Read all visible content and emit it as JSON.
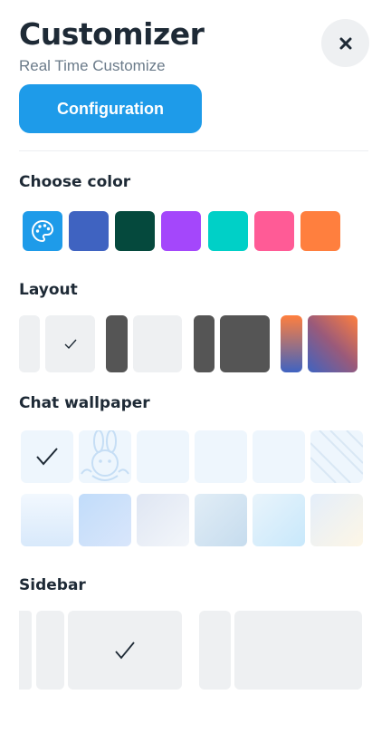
{
  "header": {
    "title": "Customizer",
    "subtitle": "Real Time Customize",
    "close_icon": "close-icon"
  },
  "configuration_button": {
    "label": "Configuration"
  },
  "sections": {
    "color": {
      "title": "Choose color"
    },
    "layout": {
      "title": "Layout"
    },
    "wallpaper": {
      "title": "Chat wallpaper"
    },
    "sidebar": {
      "title": "Sidebar"
    }
  },
  "colors": [
    {
      "name": "palette",
      "hex": "#1e9be9",
      "icon": "palette-icon",
      "selected": true
    },
    {
      "name": "blue",
      "hex": "#3f63c1"
    },
    {
      "name": "dark-green",
      "hex": "#05493d"
    },
    {
      "name": "purple",
      "hex": "#a447fb"
    },
    {
      "name": "teal",
      "hex": "#00d0c7"
    },
    {
      "name": "pink",
      "hex": "#ff5b96"
    },
    {
      "name": "orange",
      "hex": "#ff7f3e"
    }
  ],
  "layout_options": [
    {
      "name": "light",
      "selected": true
    },
    {
      "name": "dark",
      "selected": false
    },
    {
      "name": "full-dark",
      "selected": false
    },
    {
      "name": "gradient",
      "selected": false
    }
  ],
  "wallpapers": {
    "selected_index": 0,
    "count": 12
  },
  "sidebar_options": [
    {
      "name": "compact",
      "selected": true
    },
    {
      "name": "wide",
      "selected": false
    }
  ],
  "check_icon": "checkmark-icon"
}
